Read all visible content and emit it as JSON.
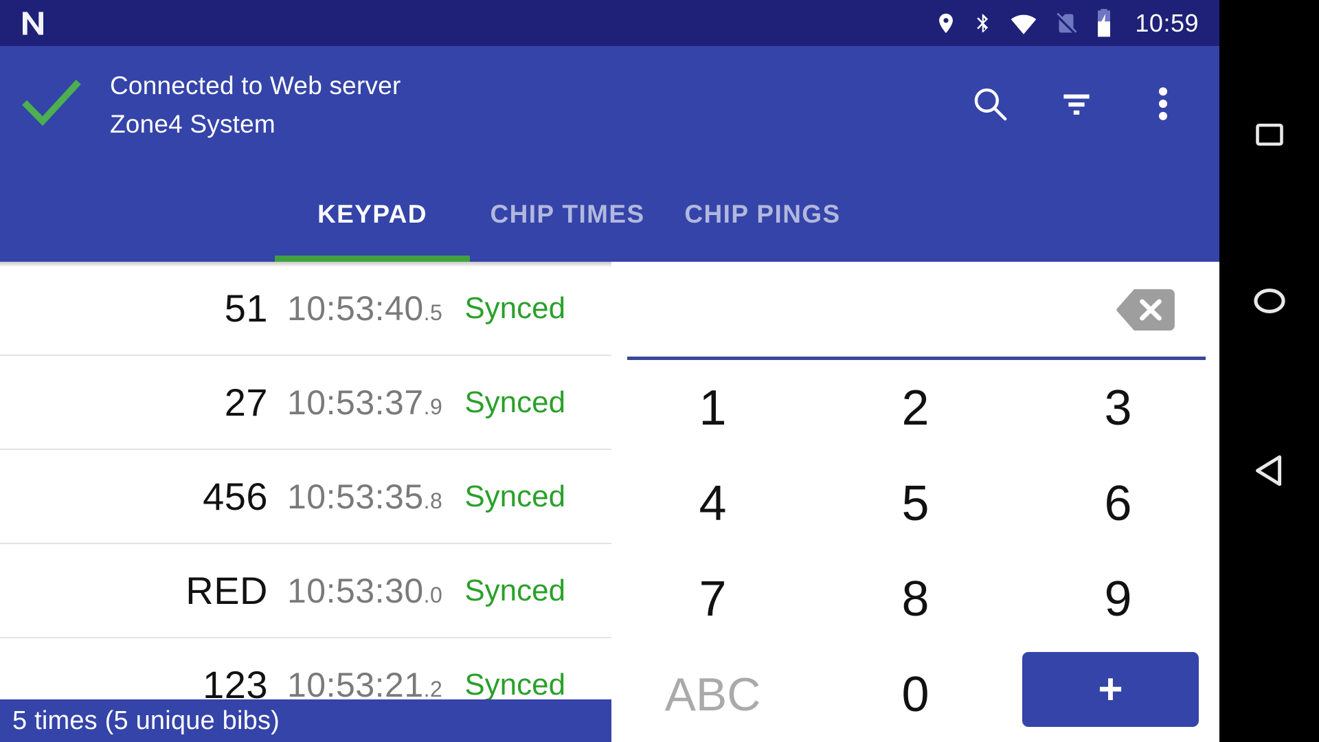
{
  "statusbar": {
    "clock": "10:59",
    "icons": [
      "android-n-logo",
      "location-icon",
      "bluetooth-icon",
      "wifi-icon",
      "no-sim-icon",
      "battery-charging-icon"
    ]
  },
  "appbar": {
    "status_icon": "check-icon",
    "title_line1": "Connected to Web server",
    "title_line2": "Zone4 System",
    "actions": [
      {
        "name": "search-icon",
        "label": "Search"
      },
      {
        "name": "filter-icon",
        "label": "Filter"
      },
      {
        "name": "overflow-menu-icon",
        "label": "More options"
      }
    ],
    "accent_color": "#3fa23f",
    "bar_color": "#3544a8",
    "statusbar_color": "#1e2177"
  },
  "tabs": [
    {
      "label": "KEYPAD",
      "active": true
    },
    {
      "label": "CHIP TIMES",
      "active": false
    },
    {
      "label": "CHIP PINGS",
      "active": false
    }
  ],
  "times": {
    "rows": [
      {
        "bib": "51",
        "time": "10:53:40",
        "frac": ".5",
        "status": "Synced"
      },
      {
        "bib": "27",
        "time": "10:53:37",
        "frac": ".9",
        "status": "Synced"
      },
      {
        "bib": "456",
        "time": "10:53:35",
        "frac": ".8",
        "status": "Synced"
      },
      {
        "bib": "RED",
        "time": "10:53:30",
        "frac": ".0",
        "status": "Synced"
      },
      {
        "bib": "123",
        "time": "10:53:21",
        "frac": ".2",
        "status": "Synced"
      }
    ],
    "status_color": "#2aa02a",
    "snackbar": "5 times (5 unique bibs)"
  },
  "keypad": {
    "entry_value": "",
    "entry_placeholder": "",
    "backspace_icon": "backspace-icon",
    "keys": [
      {
        "label": "1",
        "type": "digit"
      },
      {
        "label": "2",
        "type": "digit"
      },
      {
        "label": "3",
        "type": "digit"
      },
      {
        "label": "4",
        "type": "digit"
      },
      {
        "label": "5",
        "type": "digit"
      },
      {
        "label": "6",
        "type": "digit"
      },
      {
        "label": "7",
        "type": "digit"
      },
      {
        "label": "8",
        "type": "digit"
      },
      {
        "label": "9",
        "type": "digit"
      },
      {
        "label": "ABC",
        "type": "alpha"
      },
      {
        "label": "0",
        "type": "digit"
      },
      {
        "label": "+",
        "type": "submit"
      }
    ]
  },
  "navbar": {
    "buttons": [
      {
        "name": "recents-icon",
        "label": "Recents"
      },
      {
        "name": "home-icon",
        "label": "Home"
      },
      {
        "name": "back-icon",
        "label": "Back"
      }
    ]
  }
}
